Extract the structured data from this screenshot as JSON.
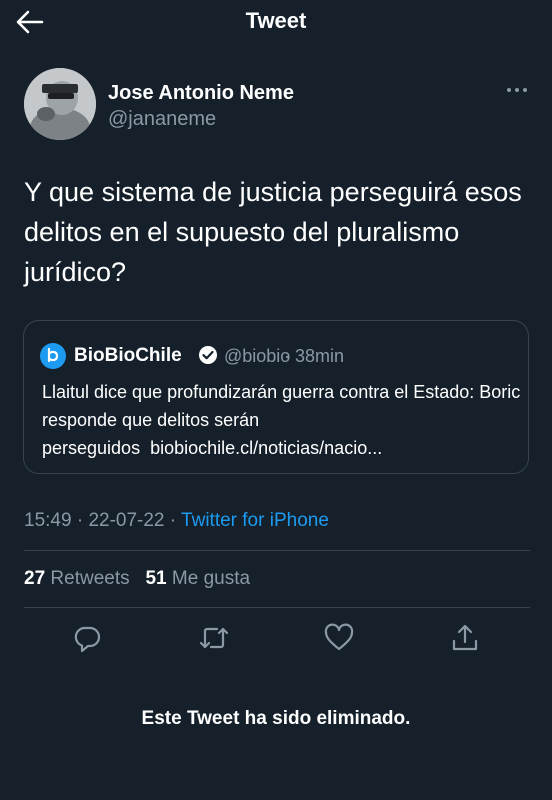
{
  "header": {
    "title": "Tweet"
  },
  "author": {
    "name": "Jose Antonio Neme",
    "handle": "@jananeme"
  },
  "tweet": {
    "text": "Y que sistema de justicia perseguirá esos delitos en el supuesto del pluralismo jurídico?"
  },
  "quote": {
    "name": "BioBioChile",
    "handle": "@biobio",
    "separator": "·",
    "time": "38min",
    "text": "Llaitul dice que profundizarán guerra contra el Estado: Boric responde que delitos serán perseguidos",
    "link": "biobiochile.cl/noticias/nacio..."
  },
  "meta": {
    "time": "15:49",
    "dot1": " · ",
    "date": "22-07-22",
    "dot2": " · ",
    "source": "Twitter for iPhone"
  },
  "stats": {
    "retweets": "27",
    "retweets_label": "Retweets",
    "likes": "51",
    "likes_label": "Me gusta"
  },
  "status": {
    "deleted": "Este Tweet ha sido eliminado."
  },
  "icons": {
    "back": "back-arrow-icon",
    "more": "more-icon",
    "verified": "verified-badge-icon",
    "reply": "reply-icon",
    "retweet": "retweet-icon",
    "like": "like-icon",
    "share": "share-icon"
  },
  "colors": {
    "background": "#15202b",
    "link": "#1d9bf0",
    "secondary": "#8b98a5",
    "divider": "#38444d"
  }
}
